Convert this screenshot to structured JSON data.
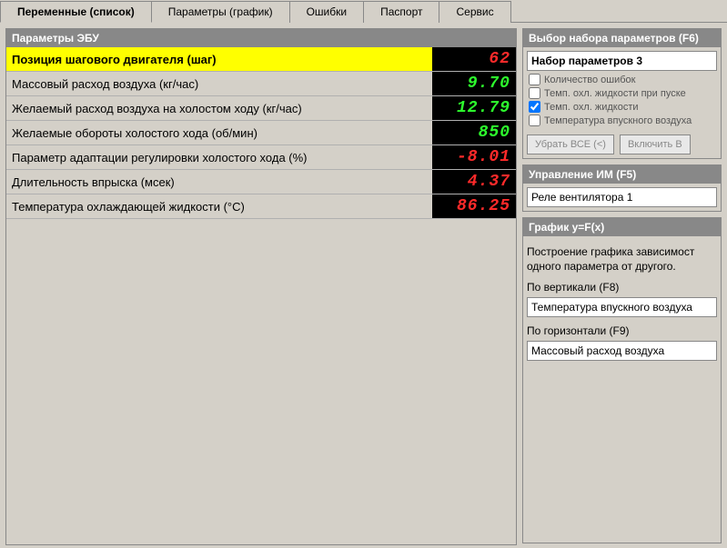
{
  "tabs": {
    "t0": "Переменные (список)",
    "t1": "Параметры (график)",
    "t2": "Ошибки",
    "t3": "Паспорт",
    "t4": "Сервис"
  },
  "paramsPanel": {
    "title": "Параметры ЭБУ",
    "rows": [
      {
        "label": "Позиция шагового двигателя (шаг)",
        "value": "62",
        "color": "red",
        "selected": true
      },
      {
        "label": "Массовый расход воздуха (кг/час)",
        "value": "9.70",
        "color": "green",
        "selected": false
      },
      {
        "label": "Желаемый расход воздуха на холостом ходу (кг/час)",
        "value": "12.79",
        "color": "green",
        "selected": false
      },
      {
        "label": "Желаемые обороты холостого хода (об/мин)",
        "value": "850",
        "color": "green",
        "selected": false
      },
      {
        "label": "Параметр адаптации регулировки холостого хода (%)",
        "value": "-8.01",
        "color": "red",
        "selected": false
      },
      {
        "label": "Длительность впрыска (мсек)",
        "value": "4.37",
        "color": "red",
        "selected": false
      },
      {
        "label": "Температура охлаждающей жидкости (°C)",
        "value": "86.25",
        "color": "red",
        "selected": false
      }
    ]
  },
  "setSelect": {
    "title": "Выбор набора параметров (F6)",
    "value": "Набор параметров 3",
    "checks": [
      {
        "label": "Количество ошибок",
        "checked": false
      },
      {
        "label": "Темп. охл. жидкости при пуске",
        "checked": false
      },
      {
        "label": "Темп. охл. жидкости",
        "checked": true
      },
      {
        "label": "Температура впускного воздуха",
        "checked": false
      }
    ],
    "btnRemove": "Убрать ВСЕ (<)",
    "btnAdd": "Включить В"
  },
  "imControl": {
    "title": "Управление ИМ (F5)",
    "value": "Реле вентилятора 1"
  },
  "graph": {
    "title": "График y=F(x)",
    "desc": "Построение графика зависимост одного параметра от другого.",
    "vLabel": "По вертикали (F8)",
    "vValue": "Температура впускного воздуха",
    "hLabel": "По горизонтали (F9)",
    "hValue": "Массовый расход воздуха"
  }
}
